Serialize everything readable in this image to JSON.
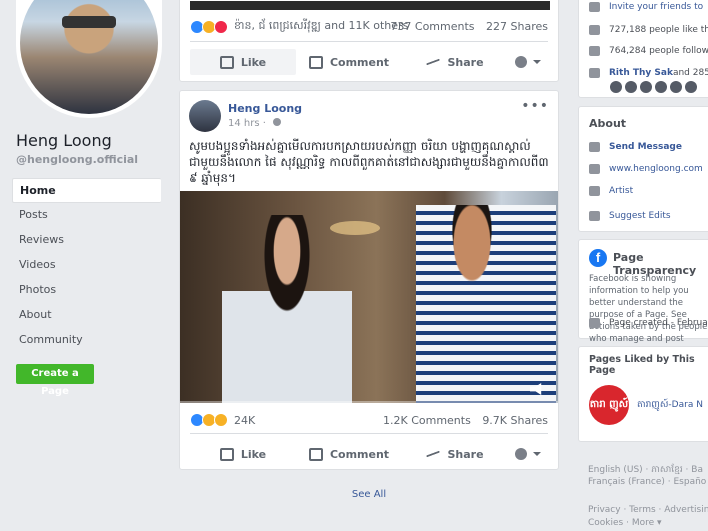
{
  "profile": {
    "name": "Heng Loong",
    "handle": "@hengloong.official"
  },
  "nav": {
    "items": [
      "Home",
      "Posts",
      "Reviews",
      "Videos",
      "Photos",
      "About",
      "Community"
    ],
    "create_page": "Create a Page"
  },
  "post1": {
    "reactors": "ខ៉ាន, ជ័ ពេជ្រសេរីវុឌ្ឍ and 11K others",
    "comments": "737 Comments",
    "shares": "227 Shares",
    "actions": {
      "like": "Like",
      "comment": "Comment",
      "share": "Share"
    }
  },
  "post2": {
    "author": "Heng Loong",
    "time": "14 hrs · ",
    "text": "សូមបងប្អូនទាំងអស់គ្នាមើលការបកស្រាយរបស់កញ្ញា ចរិយា បង្ហាញគុណស្គាល់ជាមួយនឹងលោក ផៃ សុវណ្ណារិទ្ធ កាលពីពួកគាត់នៅជាសង្សារជាមួយនឹងគ្នាកាលពី៣ ៩ ឆ្នាំមុន។",
    "reactions_count": "24K",
    "comments": "1.2K Comments",
    "shares": "9.7K Shares",
    "actions": {
      "like": "Like",
      "comment": "Comment",
      "share": "Share"
    }
  },
  "see_all": "See All",
  "right": {
    "invite": "Invite your friends to",
    "likes": "727,188 people like this",
    "follows": "764,284 people follow t",
    "friends_prefix": "Rith Thy Sak",
    "friends_suffix": " and 285",
    "about_title": "About",
    "send_message": "Send Message",
    "website": "www.hengloong.com",
    "category": "Artist",
    "suggest_edits": "Suggest Edits",
    "transparency_title": "Page Transparency",
    "transparency_text": "Facebook is showing information to help you better understand the purpose of a Page. See actions taken by the people who manage and post",
    "page_created": "Page created - February",
    "liked_title": "Pages Liked by This Page",
    "liked_page": "តារាញូស៍-Dara N",
    "liked_logo": "តារា ញូស៍",
    "languages": "English (US) · ភាសាខ្មែរ · Ba",
    "languages2": "Français (France) · Españo",
    "footer1": "Privacy · Terms · Advertising",
    "footer2": "Cookies · More ▾"
  }
}
